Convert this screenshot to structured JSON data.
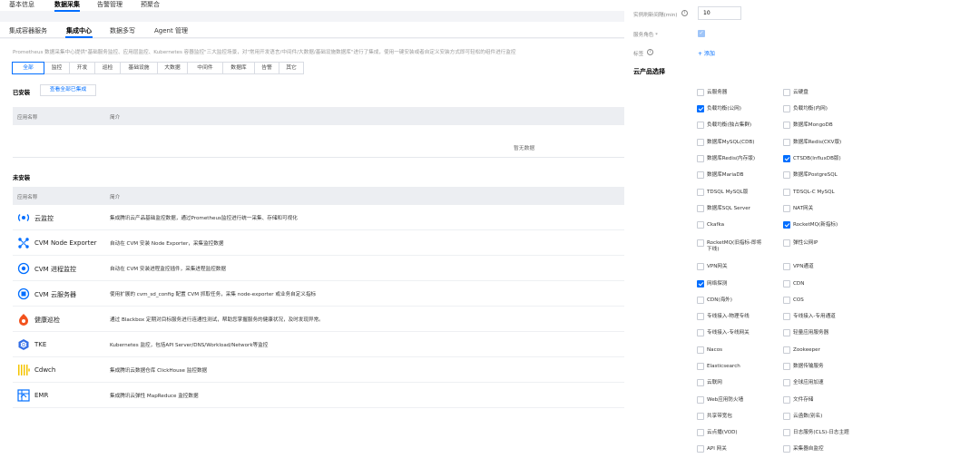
{
  "top_tabs": [
    "基本信息",
    "数据采集",
    "告警管理",
    "预聚合"
  ],
  "sub_tabs": [
    "集成容器服务",
    "集成中心",
    "数据多写",
    "Agent 管理"
  ],
  "description": "Prometheus 数据采集中心提供\"基础服务监控、应用层监控、Kubernetes 容器监控\"三大监控场景，对\"常用开发语言/中间件/大数据/基础设施数据库\"进行了集成，使用一键安装或者自定义安装方式即可轻松的组件进行监控",
  "filters": [
    "全部",
    "监控",
    "开发",
    "巡检",
    "基础设施",
    "大数据",
    "中间件",
    "数据库",
    "告警",
    "其它"
  ],
  "installed": {
    "title": "已安装",
    "view_all_label": "查看全部已集成",
    "col_name": "应用名称",
    "col_desc": "简介",
    "empty_text": "暂无数据"
  },
  "uninstalled": {
    "title": "未安装",
    "col_name": "应用名称",
    "col_desc": "简介",
    "rows": [
      {
        "name": "云监控",
        "desc": "集成腾讯云产品基础监控数据，通过Prometheus监控进行统一采集、存储和可视化",
        "icon": "cloud-monitor-icon"
      },
      {
        "name": "CVM Node Exporter",
        "desc": "自动在 CVM 安装 Node Exporter，采集监控数据",
        "icon": "node-exporter-icon"
      },
      {
        "name": "CVM 进程监控",
        "desc": "自动在 CVM 安装进程监控插件，采集进程监控数据",
        "icon": "process-monitor-icon"
      },
      {
        "name": "CVM 云服务器",
        "desc": "使用扩展的 cvm_sd_config 配置 CVM 抓取任务，采集 node-exporter 或业务自定义指标",
        "icon": "cvm-server-icon"
      },
      {
        "name": "健康巡检",
        "desc": "通过 Blackbox 定期对目标服务进行连通性测试，帮助您掌握服务的健康状况，及时发现异常。",
        "icon": "health-check-icon"
      },
      {
        "name": "TKE",
        "desc": "Kubernetes 监控，包括API Server/DNS/Workload/Network等监控",
        "icon": "tke-icon"
      },
      {
        "name": "Cdwch",
        "desc": "集成腾讯云数据仓库 ClickHouse 监控数据",
        "icon": "cdwch-icon"
      },
      {
        "name": "EMR",
        "desc": "集成腾讯云弹性 MapReduce 监控数据",
        "icon": "emr-icon"
      }
    ]
  },
  "right_panel": {
    "interval_label": "实例刷新间隔(min)",
    "interval_value": "10",
    "role_label": "服务角色 *",
    "tag_label": "标签",
    "add_label": "+ 添加",
    "products_title": "云产品选择",
    "products": [
      {
        "label": "云服务器",
        "checked": false
      },
      {
        "label": "云硬盘",
        "checked": false
      },
      {
        "label": "负载均衡(公网)",
        "checked": true
      },
      {
        "label": "负载均衡(内网)",
        "checked": false
      },
      {
        "label": "负载均衡(独占集群)",
        "checked": false
      },
      {
        "label": "数据库MongoDB",
        "checked": false
      },
      {
        "label": "数据库MySQL(CDB)",
        "checked": false
      },
      {
        "label": "数据库Redis(CKV版)",
        "checked": false
      },
      {
        "label": "数据库Redis(内存版)",
        "checked": false
      },
      {
        "label": "CTSDB(InfluxDB版)",
        "checked": true
      },
      {
        "label": "数据库MariaDB",
        "checked": false
      },
      {
        "label": "数据库PostgreSQL",
        "checked": false
      },
      {
        "label": "TDSQL MySQL版",
        "checked": false
      },
      {
        "label": "TDSQL-C MySQL",
        "checked": false
      },
      {
        "label": "数据库SQL Server",
        "checked": false
      },
      {
        "label": "NAT网关",
        "checked": false
      },
      {
        "label": "Ckafka",
        "checked": false
      },
      {
        "label": "RocketMQ(新指标)",
        "checked": true
      },
      {
        "label": "RocketMQ(旧指标-即将下线)",
        "checked": false
      },
      {
        "label": "弹性公网IP",
        "checked": false
      },
      {
        "label": "VPN网关",
        "checked": false
      },
      {
        "label": "VPN通道",
        "checked": false
      },
      {
        "label": "网络探测",
        "checked": true
      },
      {
        "label": "CDN",
        "checked": false
      },
      {
        "label": "CDN(海外)",
        "checked": false
      },
      {
        "label": "COS",
        "checked": false
      },
      {
        "label": "专线接入-物理专线",
        "checked": false
      },
      {
        "label": "专线接入-专用通道",
        "checked": false
      },
      {
        "label": "专线接入-专线网关",
        "checked": false
      },
      {
        "label": "轻量应用服务器",
        "checked": false
      },
      {
        "label": "Nacos",
        "checked": false
      },
      {
        "label": "Zookeeper",
        "checked": false
      },
      {
        "label": "Elasticsearch",
        "checked": false
      },
      {
        "label": "数据传输服务",
        "checked": false
      },
      {
        "label": "云联网",
        "checked": false
      },
      {
        "label": "全球应用加速",
        "checked": false
      },
      {
        "label": "Web应用防火墙",
        "checked": false
      },
      {
        "label": "文件存储",
        "checked": false
      },
      {
        "label": "共享带宽包",
        "checked": false
      },
      {
        "label": "云函数(别名)",
        "checked": false
      },
      {
        "label": "云点播(VOD)",
        "checked": false
      },
      {
        "label": "日志服务(CLS)-日志主题",
        "checked": false
      },
      {
        "label": "API 网关",
        "checked": false
      },
      {
        "label": "采集器自监控",
        "checked": false
      }
    ]
  }
}
